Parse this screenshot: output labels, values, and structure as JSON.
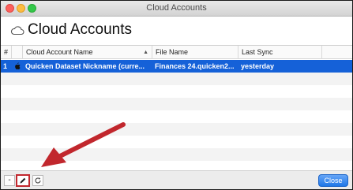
{
  "window": {
    "title": "Cloud Accounts"
  },
  "header": {
    "icon": "cloud-icon",
    "title": "Cloud Accounts"
  },
  "table": {
    "columns": [
      "#",
      "",
      "Cloud Account Name",
      "File Name",
      "Last Sync"
    ],
    "sorted_column": "Cloud Account Name",
    "rows": [
      {
        "num": "1",
        "icon": "apple-icon",
        "name": "Quicken Dataset Nickname (curre...",
        "file": "Finances 24.quicken2...",
        "sync": "yesterday",
        "selected": true
      }
    ]
  },
  "footer": {
    "minus_label": "-",
    "edit_icon": "pencil-icon",
    "refresh_icon": "refresh-icon",
    "close_label": "Close"
  },
  "colors": {
    "selection": "#1561d8",
    "highlight_box": "#c1272d",
    "annotation_arrow": "#c1272d",
    "close_button": "#1f78e8"
  }
}
